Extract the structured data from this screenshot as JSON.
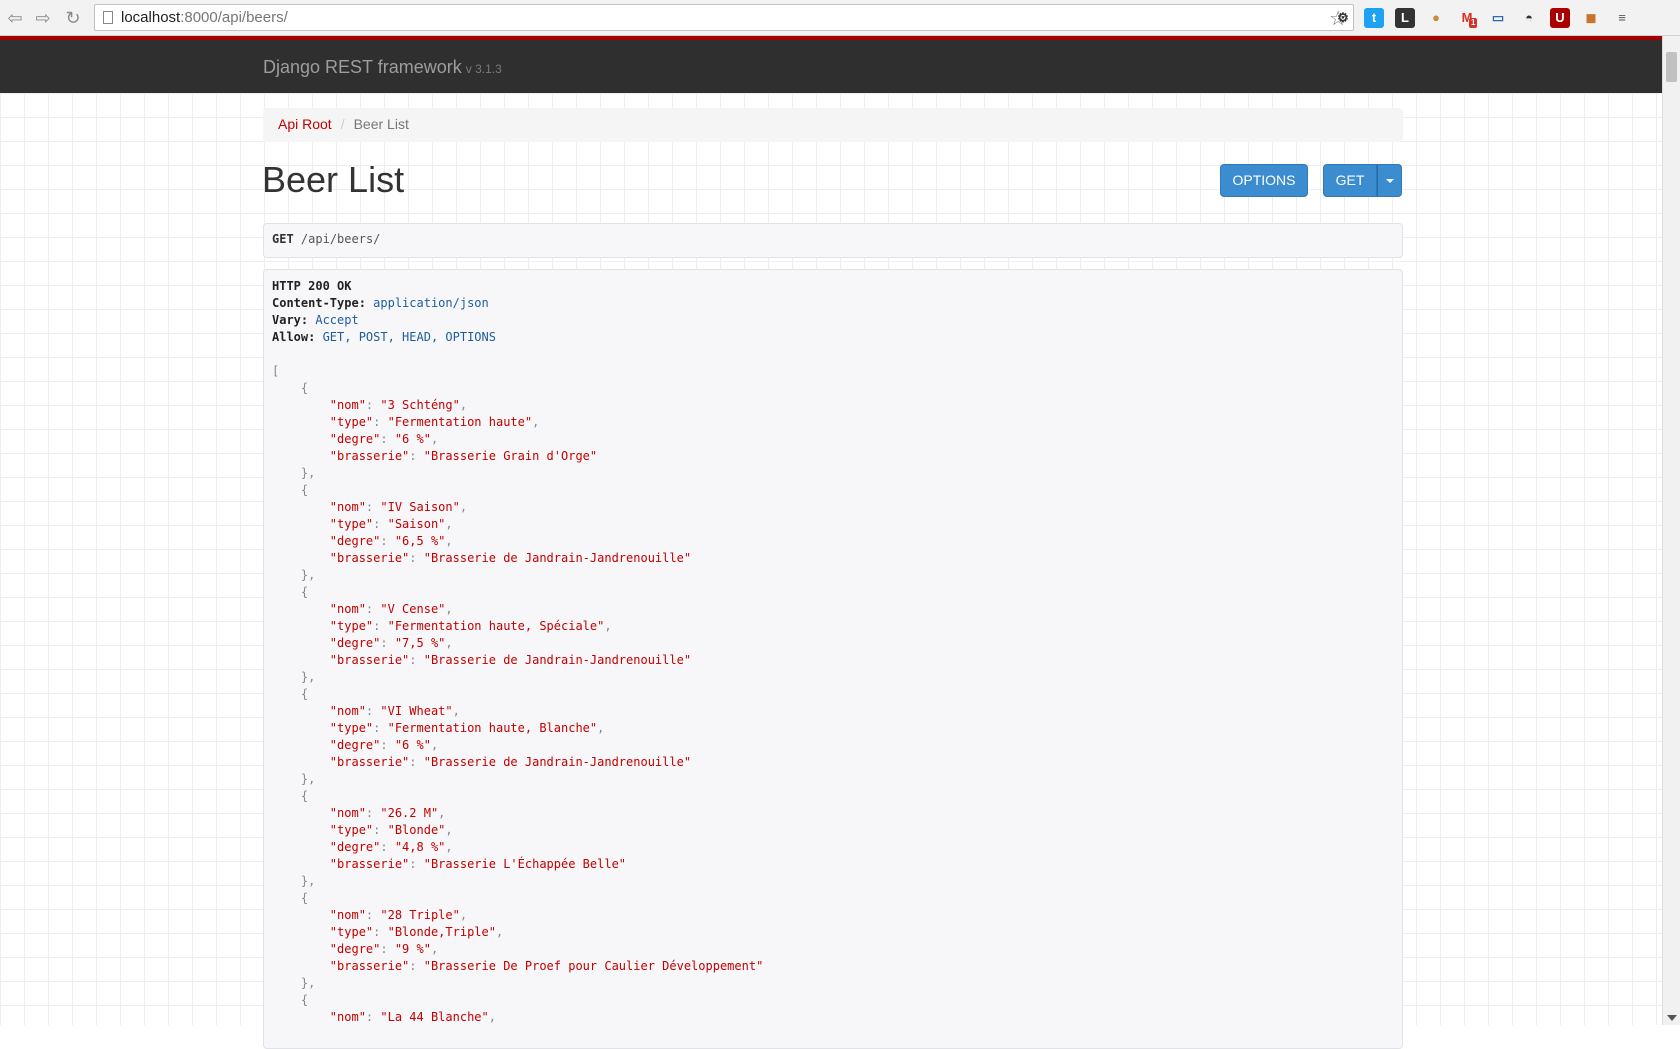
{
  "browser": {
    "url_host": "localhost",
    "url_rest": ":8000/api/beers/",
    "extensions": [
      {
        "name": "gear-icon",
        "glyph": "⚙",
        "color": "#333",
        "bg": "transparent"
      },
      {
        "name": "twitter-icon",
        "glyph": "t",
        "color": "#fff",
        "bg": "#1da1f2"
      },
      {
        "name": "l-extension-icon",
        "glyph": "L",
        "color": "#fff",
        "bg": "#333"
      },
      {
        "name": "cookie-icon",
        "glyph": "●",
        "color": "#c98a3c",
        "bg": "transparent"
      },
      {
        "name": "gmail-icon",
        "glyph": "M",
        "color": "#d93025",
        "bg": "transparent"
      },
      {
        "name": "screenshot-icon",
        "glyph": "▭",
        "color": "#2a6bb0",
        "bg": "transparent"
      },
      {
        "name": "mask-icon",
        "glyph": "◓",
        "color": "#333",
        "bg": "transparent"
      },
      {
        "name": "ublock-icon",
        "glyph": "U",
        "color": "#fff",
        "bg": "#a00"
      },
      {
        "name": "bag-icon",
        "glyph": "◼",
        "color": "#c8742a",
        "bg": "transparent"
      },
      {
        "name": "menu-icon",
        "glyph": "≡",
        "color": "#555",
        "bg": "transparent"
      }
    ],
    "gmail_badge": "1"
  },
  "navbar": {
    "brand": "Django REST framework",
    "version": "v 3.1.3"
  },
  "breadcrumb": {
    "root": "Api Root",
    "current": "Beer List"
  },
  "page": {
    "title": "Beer List",
    "options_label": "OPTIONS",
    "get_label": "GET"
  },
  "request": {
    "method": "GET",
    "path": "/api/beers/"
  },
  "response": {
    "status": "HTTP 200 OK",
    "headers": [
      {
        "key": "Content-Type:",
        "value": "application/json"
      },
      {
        "key": "Vary:",
        "value": "Accept"
      },
      {
        "key": "Allow:",
        "value": "GET, POST, HEAD, OPTIONS"
      }
    ],
    "beers": [
      {
        "nom": "3 Schténg",
        "type": "Fermentation haute",
        "degre": "6 %",
        "brasserie": "Brasserie Grain d'Orge"
      },
      {
        "nom": "IV Saison",
        "type": "Saison",
        "degre": "6,5 %",
        "brasserie": "Brasserie de Jandrain-Jandrenouille"
      },
      {
        "nom": "V Cense",
        "type": "Fermentation haute, Spéciale",
        "degre": "7,5 %",
        "brasserie": "Brasserie de Jandrain-Jandrenouille"
      },
      {
        "nom": "VI Wheat",
        "type": "Fermentation haute, Blanche",
        "degre": "6 %",
        "brasserie": "Brasserie de Jandrain-Jandrenouille"
      },
      {
        "nom": "26.2 M",
        "type": "Blonde",
        "degre": "4,8 %",
        "brasserie": "Brasserie L'Échappée Belle"
      },
      {
        "nom": "28 Triple",
        "type": "Blonde,Triple",
        "degre": "9 %",
        "brasserie": "Brasserie De Proef pour Caulier Développement"
      },
      {
        "nom": "La 44 Blanche"
      }
    ]
  }
}
